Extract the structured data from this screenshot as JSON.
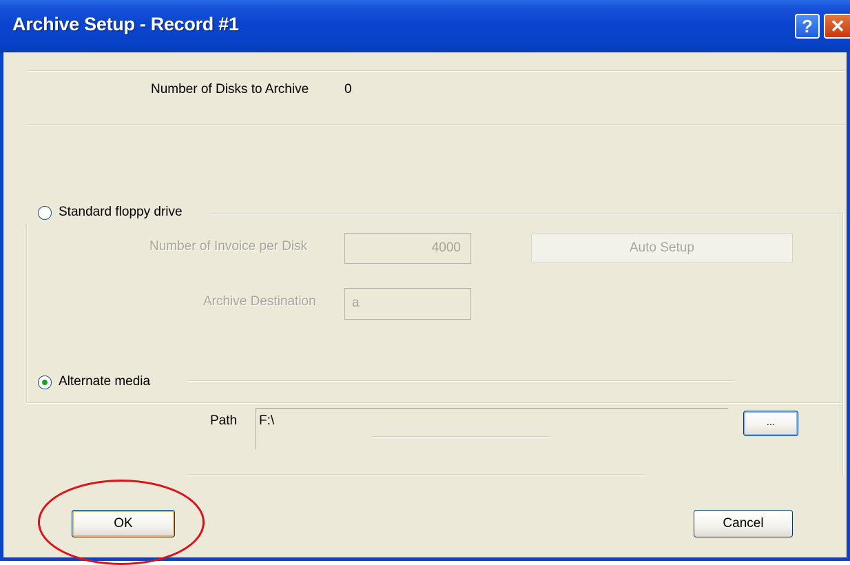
{
  "window": {
    "title": "Archive Setup - Record #1",
    "help_glyph": "?",
    "close_glyph": "✕"
  },
  "summary": {
    "disks_label": "Number of Disks to Archive",
    "disks_value": "0"
  },
  "floppy": {
    "radio_label": "Standard floppy drive",
    "selected": false,
    "invoices_label": "Number of Invoice per Disk",
    "invoices_value": "4000",
    "auto_setup_label": "Auto Setup",
    "destination_label": "Archive Destination",
    "destination_value": "a"
  },
  "alternate": {
    "radio_label": "Alternate media",
    "selected": true,
    "path_label": "Path",
    "path_value": "F:\\",
    "browse_label": "..."
  },
  "buttons": {
    "ok_label": "OK",
    "cancel_label": "Cancel"
  },
  "colors": {
    "titlebar": "#0a45cf",
    "dialog_bg": "#ece9d8",
    "annotation": "#e0101a"
  }
}
